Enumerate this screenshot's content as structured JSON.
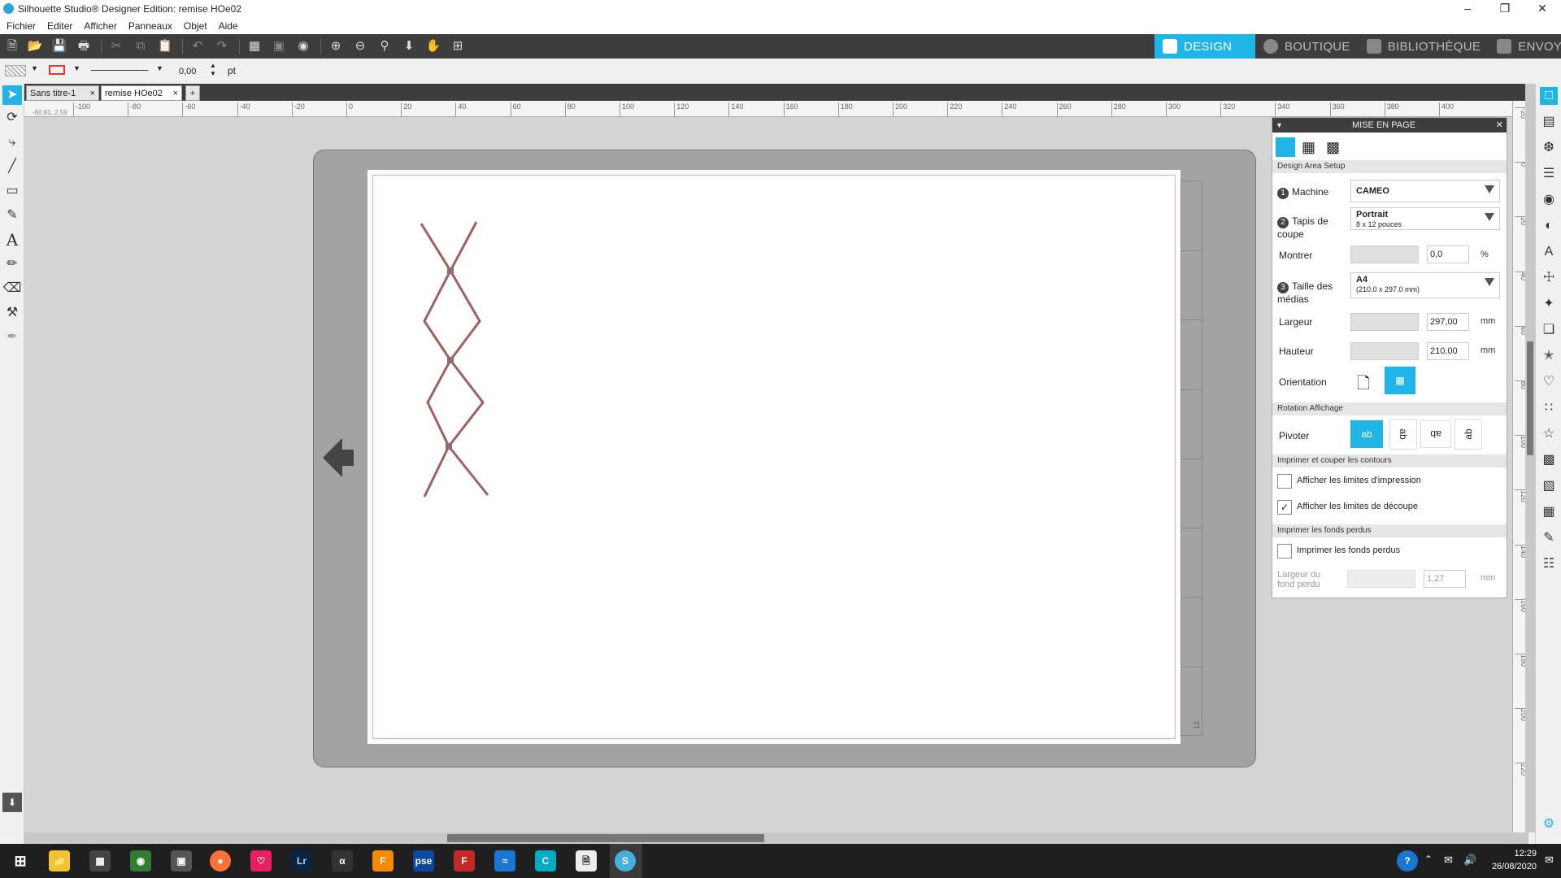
{
  "window": {
    "title": "Silhouette Studio® Designer Edition: remise HOe02"
  },
  "menu": [
    "Fichier",
    "Editer",
    "Afficher",
    "Panneaux",
    "Objet",
    "Aide"
  ],
  "nav_tabs": [
    {
      "label": "DESIGN",
      "active": true
    },
    {
      "label": "BOUTIQUE",
      "active": false
    },
    {
      "label": "BIBLIOTHÈQUE",
      "active": false
    },
    {
      "label": "ENVOYER",
      "active": false
    }
  ],
  "properties": {
    "line_width": "0,00",
    "unit": "pt"
  },
  "doc_tabs": [
    {
      "label": "Sans titre-1",
      "active": false
    },
    {
      "label": "remise HOe02",
      "active": true
    }
  ],
  "ruler": {
    "h_labels": [
      "-100",
      "-80",
      "-60",
      "-40",
      "-20",
      "0",
      "20",
      "40",
      "60",
      "80",
      "100",
      "120",
      "140",
      "160",
      "180",
      "200",
      "220",
      "240",
      "260",
      "280",
      "300",
      "320",
      "340",
      "360",
      "380",
      "400"
    ],
    "v_labels": [
      "-20",
      "0",
      "20",
      "40",
      "60",
      "80",
      "100",
      "120",
      "140",
      "160",
      "180",
      "200",
      "220"
    ],
    "coords": "-60.81, 2.59"
  },
  "mat": {
    "corner_label": "12"
  },
  "panel": {
    "title": "MISE EN PAGE",
    "section_design": "Design Area Setup",
    "machine_label": "Machine",
    "machine_value": "CAMEO",
    "mat_label": "Tapis de coupe",
    "mat_value": "Portrait",
    "mat_sub": "8 x 12 pouces",
    "show_label": "Montrer",
    "show_value": "0,0",
    "show_unit": "%",
    "media_label": "Taille des médias",
    "media_value": "A4",
    "media_sub": "(210.0 x 297.0 mm)",
    "width_label": "Largeur",
    "width_value": "297,00",
    "height_label": "Hauteur",
    "height_value": "210,00",
    "mm": "mm",
    "orientation_label": "Orientation",
    "section_rotation": "Rotation Affichage",
    "pivot_label": "Pivoter",
    "pivot_options": [
      "ab",
      "ab",
      "ab",
      "ab"
    ],
    "section_print": "Imprimer et couper les contours",
    "chk_print_limits": "Afficher les limites d'impression",
    "chk_cut_limits": "Afficher les limites de découpe",
    "section_bleed": "Imprimer les fonds perdus",
    "chk_bleed": "Imprimer les fonds perdus",
    "bleed_width_label": "Largeur du fond perdu",
    "bleed_value": "1,27",
    "numbers": [
      "1",
      "2",
      "3"
    ],
    "checked": {
      "print_limits": false,
      "cut_limits": true,
      "bleed": false
    }
  },
  "taskbar": {
    "time": "12:29",
    "date": "26/08/2020"
  },
  "colors": {
    "accent": "#1fb5e6",
    "shape": "#a0605e",
    "toolbar": "#3d3d3d"
  }
}
